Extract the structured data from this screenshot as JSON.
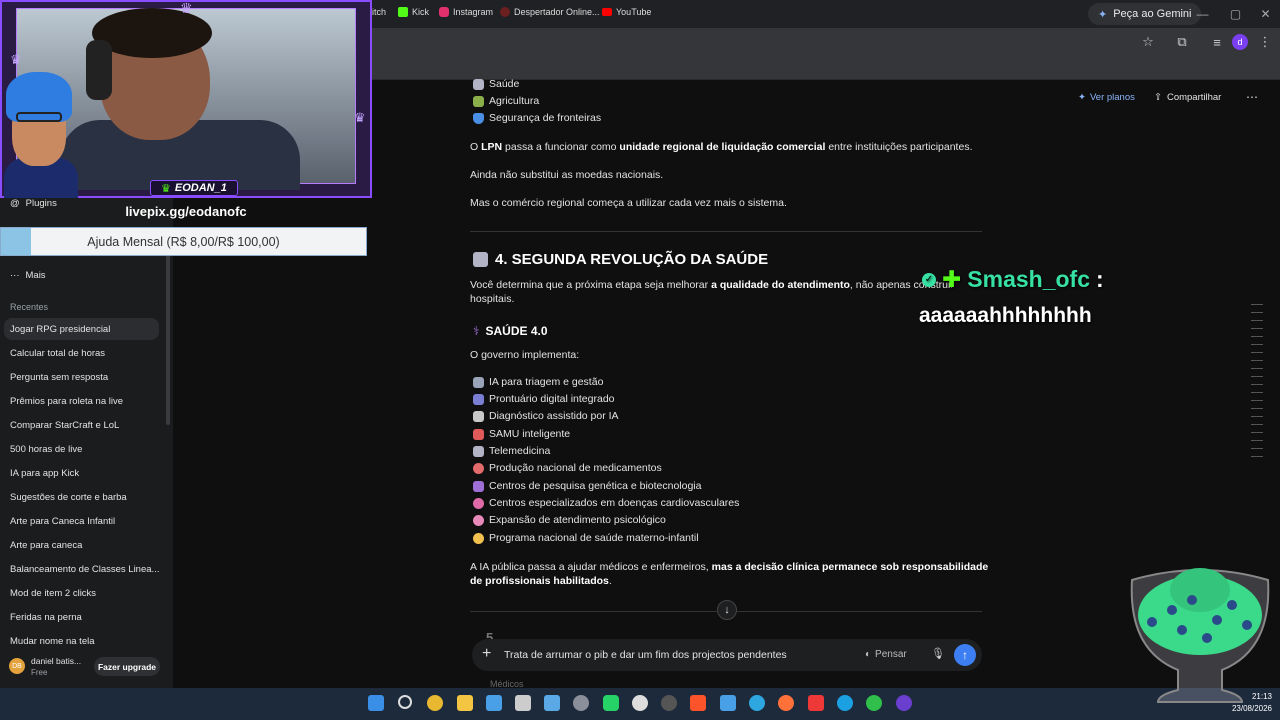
{
  "browser": {
    "gemini_button": "Peça ao Gemini",
    "profile_letter": "d",
    "bookmarks": [
      {
        "label": "itch",
        "color": "#9146ff"
      },
      {
        "label": "Kick",
        "color": "#53fc18"
      },
      {
        "label": "Instagram",
        "color": "#e1306c"
      },
      {
        "label": "Despertador Online...",
        "color": "#e53935"
      },
      {
        "label": "YouTube",
        "color": "#ff0000"
      }
    ]
  },
  "sidebar": {
    "plugins_label": "Plugins",
    "more_label": "Mais",
    "recent_header": "Recentes",
    "recents": [
      "Jogar RPG presidencial",
      "Calcular total de horas",
      "Pergunta sem resposta",
      "Prêmios para roleta na live",
      "Comparar StarCraft e LoL",
      "500 horas de live",
      "IA para app Kick",
      "Sugestões de corte e barba",
      "Arte para Caneca Infantil",
      "Arte para caneca",
      "Balanceamento de Classes Linea...",
      "Mod de item 2 clicks",
      "Feridas na perna",
      "Mudar nome na tela"
    ],
    "user_name": "daniel batis...",
    "user_plan": "Free",
    "upgrade_label": "Fazer upgrade"
  },
  "header": {
    "plans_label": "Ver planos",
    "share_label": "Compartilhar"
  },
  "content": {
    "top_list": [
      "Saúde",
      "Agricultura",
      "Segurança de fronteiras"
    ],
    "p1_a": "O ",
    "p1_b": "LPN",
    "p1_c": " passa a funcionar como ",
    "p1_d": "unidade regional de liquidação comercial",
    "p1_e": " entre instituições participantes.",
    "p2": "Ainda não substitui as moedas nacionais.",
    "p3": "Mas o comércio regional começa a utilizar cada vez mais o sistema.",
    "h2": "4. SEGUNDA REVOLUÇÃO DA SAÚDE",
    "p4_a": "Você determina que a próxima etapa seja melhorar ",
    "p4_b": "a qualidade do atendimento",
    "p4_c": ", não apenas construir",
    "p4_d": "hospitais.",
    "h3": "SAÚDE 4.0",
    "p5": "O governo implementa:",
    "health_list": [
      {
        "text": "IA para triagem e gestão",
        "color": "#9aa4b8"
      },
      {
        "text": "Prontuário digital integrado",
        "color": "#7b7fd4"
      },
      {
        "text": "Diagnóstico assistido por IA",
        "color": "#c9c9c9"
      },
      {
        "text": "SAMU inteligente",
        "color": "#e05a5a"
      },
      {
        "text": "Telemedicina",
        "color": "#b3b3c6"
      },
      {
        "text": "Produção nacional de medicamentos",
        "color": "#e46b6b"
      },
      {
        "text": "Centros de pesquisa genética e biotecnologia",
        "color": "#9f6fd8"
      },
      {
        "text": "Centros especializados em doenças cardiovasculares",
        "color": "#e06aa7"
      },
      {
        "text": "Expansão de atendimento psicológico",
        "color": "#e78ab9"
      },
      {
        "text": "Programa nacional de saúde materno-infantil",
        "color": "#f2c14e"
      }
    ],
    "p6_a": "A IA pública passa a ajudar médicos e enfermeiros, ",
    "p6_b": "mas a decisão clínica permanece sob responsabilidade",
    "p6_c": "de profissionais habilitados",
    "p6_d": ".",
    "next_heading_partial": "5. ...",
    "partial_bottom": "Médicos"
  },
  "composer": {
    "value": "Trata de arrumar o pib e dar um fim dos projectos pendentes",
    "think_label": "Pensar"
  },
  "overlay": {
    "streamer_name": "EODAN_1",
    "livepix": "livepix.gg/eodanofc",
    "donation_label": "Ajuda Mensal (R$ 8,00/R$ 100,00)",
    "donation_progress": 0.08,
    "chat_user": "Smash_ofc",
    "chat_colon": ":",
    "chat_message": "aaaaaahhhhhhhh"
  },
  "taskbar": {
    "time": "21:13",
    "date": "23/08/2026"
  },
  "colors": {
    "accent": "#3d7ff3",
    "overlay_purple": "#8a4cff",
    "chat_green": "#37e0a3"
  }
}
